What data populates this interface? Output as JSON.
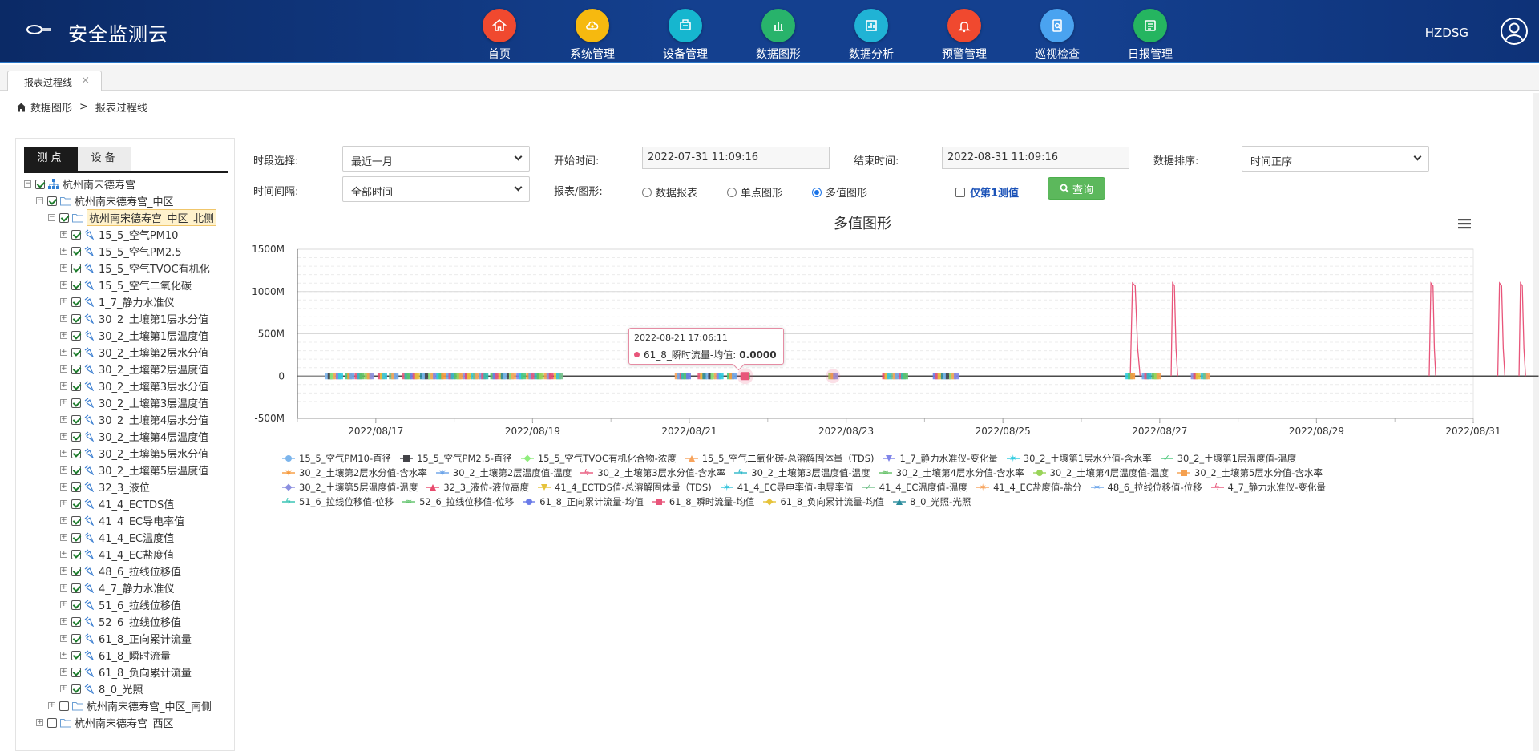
{
  "app": {
    "title": "安全监测云",
    "user": "HZDSG"
  },
  "nav": [
    {
      "label": "首页",
      "color": "#f0492f",
      "icon": "home-icon"
    },
    {
      "label": "系统管理",
      "color": "#f6b90f",
      "icon": "cloud-settings-icon"
    },
    {
      "label": "设备管理",
      "color": "#16b6cf",
      "icon": "device-icon"
    },
    {
      "label": "数据图形",
      "color": "#28b36b",
      "icon": "chart-bars-icon"
    },
    {
      "label": "数据分析",
      "color": "#20b3d5",
      "icon": "analysis-icon"
    },
    {
      "label": "预警管理",
      "color": "#f0492f",
      "icon": "bell-icon"
    },
    {
      "label": "巡视检查",
      "color": "#4aa3f0",
      "icon": "inspection-icon"
    },
    {
      "label": "日报管理",
      "color": "#25b560",
      "icon": "report-icon"
    }
  ],
  "tabs": [
    {
      "label": "报表过程线"
    }
  ],
  "breadcrumb": {
    "root": "数据图形",
    "sep": ">",
    "current": "报表过程线"
  },
  "panel": {
    "tab_points": "测点",
    "tab_devices": "设备"
  },
  "tree": [
    {
      "label": "杭州南宋德寿宫",
      "level": 0,
      "toggle": "⊟",
      "checked": true,
      "icon": "org-tree-icon"
    },
    {
      "label": "杭州南宋德寿宫_中区",
      "level": 1,
      "toggle": "⊟",
      "checked": true,
      "icon": "folder-icon"
    },
    {
      "label": "杭州南宋德寿宫_中区_北侧",
      "level": 2,
      "toggle": "⊟",
      "checked": true,
      "icon": "folder-icon",
      "selected": true
    },
    {
      "label": "15_5_空气PM10",
      "level": 3,
      "toggle": "⊞",
      "checked": true,
      "icon": "sensor-icon"
    },
    {
      "label": "15_5_空气PM2.5",
      "level": 3,
      "toggle": "⊞",
      "checked": true,
      "icon": "sensor-icon"
    },
    {
      "label": "15_5_空气TVOC有机化",
      "level": 3,
      "toggle": "⊞",
      "checked": true,
      "icon": "sensor-icon"
    },
    {
      "label": "15_5_空气二氧化碳",
      "level": 3,
      "toggle": "⊞",
      "checked": true,
      "icon": "sensor-icon"
    },
    {
      "label": "1_7_静力水准仪",
      "level": 3,
      "toggle": "⊞",
      "checked": true,
      "icon": "sensor-icon"
    },
    {
      "label": "30_2_土壤第1层水分值",
      "level": 3,
      "toggle": "⊞",
      "checked": true,
      "icon": "sensor-icon"
    },
    {
      "label": "30_2_土壤第1层温度值",
      "level": 3,
      "toggle": "⊞",
      "checked": true,
      "icon": "sensor-icon"
    },
    {
      "label": "30_2_土壤第2层水分值",
      "level": 3,
      "toggle": "⊞",
      "checked": true,
      "icon": "sensor-icon"
    },
    {
      "label": "30_2_土壤第2层温度值",
      "level": 3,
      "toggle": "⊞",
      "checked": true,
      "icon": "sensor-icon"
    },
    {
      "label": "30_2_土壤第3层水分值",
      "level": 3,
      "toggle": "⊞",
      "checked": true,
      "icon": "sensor-icon"
    },
    {
      "label": "30_2_土壤第3层温度值",
      "level": 3,
      "toggle": "⊞",
      "checked": true,
      "icon": "sensor-icon"
    },
    {
      "label": "30_2_土壤第4层水分值",
      "level": 3,
      "toggle": "⊞",
      "checked": true,
      "icon": "sensor-icon"
    },
    {
      "label": "30_2_土壤第4层温度值",
      "level": 3,
      "toggle": "⊞",
      "checked": true,
      "icon": "sensor-icon"
    },
    {
      "label": "30_2_土壤第5层水分值",
      "level": 3,
      "toggle": "⊞",
      "checked": true,
      "icon": "sensor-icon"
    },
    {
      "label": "30_2_土壤第5层温度值",
      "level": 3,
      "toggle": "⊞",
      "checked": true,
      "icon": "sensor-icon"
    },
    {
      "label": "32_3_液位",
      "level": 3,
      "toggle": "⊞",
      "checked": true,
      "icon": "sensor-icon"
    },
    {
      "label": "41_4_ECTDS值",
      "level": 3,
      "toggle": "⊞",
      "checked": true,
      "icon": "sensor-icon"
    },
    {
      "label": "41_4_EC导电率值",
      "level": 3,
      "toggle": "⊞",
      "checked": true,
      "icon": "sensor-icon"
    },
    {
      "label": "41_4_EC温度值",
      "level": 3,
      "toggle": "⊞",
      "checked": true,
      "icon": "sensor-icon"
    },
    {
      "label": "41_4_EC盐度值",
      "level": 3,
      "toggle": "⊞",
      "checked": true,
      "icon": "sensor-icon"
    },
    {
      "label": "48_6_拉线位移值",
      "level": 3,
      "toggle": "⊞",
      "checked": true,
      "icon": "sensor-icon"
    },
    {
      "label": "4_7_静力水准仪",
      "level": 3,
      "toggle": "⊞",
      "checked": true,
      "icon": "sensor-icon"
    },
    {
      "label": "51_6_拉线位移值",
      "level": 3,
      "toggle": "⊞",
      "checked": true,
      "icon": "sensor-icon"
    },
    {
      "label": "52_6_拉线位移值",
      "level": 3,
      "toggle": "⊞",
      "checked": true,
      "icon": "sensor-icon"
    },
    {
      "label": "61_8_正向累计流量",
      "level": 3,
      "toggle": "⊞",
      "checked": true,
      "icon": "sensor-icon"
    },
    {
      "label": "61_8_瞬时流量",
      "level": 3,
      "toggle": "⊞",
      "checked": true,
      "icon": "sensor-icon"
    },
    {
      "label": "61_8_负向累计流量",
      "level": 3,
      "toggle": "⊞",
      "checked": true,
      "icon": "sensor-icon"
    },
    {
      "label": "8_0_光照",
      "level": 3,
      "toggle": "⊞",
      "checked": true,
      "icon": "sensor-icon"
    },
    {
      "label": "杭州南宋德寿宫_中区_南侧",
      "level": 2,
      "toggle": "⊞",
      "checked": false,
      "icon": "folder-icon"
    },
    {
      "label": "杭州南宋德寿宫_西区",
      "level": 1,
      "toggle": "⊞",
      "checked": false,
      "icon": "folder-icon"
    }
  ],
  "filters": {
    "period_label": "时段选择:",
    "period_value": "最近一月",
    "start_label": "开始时间:",
    "start_value": "2022-07-31 11:09:16",
    "end_label": "结束时间:",
    "end_value": "2022-08-31 11:09:16",
    "sort_label": "数据排序:",
    "sort_value": "时间正序",
    "interval_label": "时间间隔:",
    "interval_value": "全部时间",
    "type_label": "报表/图形:",
    "radio_report": "数据报表",
    "radio_single": "单点图形",
    "radio_multi": "多值图形",
    "only_first": "仅第1测值",
    "query": "查询"
  },
  "tooltip": {
    "time": "2022-08-21 17:06:11",
    "series": "61_8_瞬时流量-均值:",
    "value": "0.0000",
    "color": "#e8557a"
  },
  "chart_data": {
    "type": "line",
    "title": "多值图形",
    "x_type": "time",
    "xlim": [
      "2022-08-16",
      "2022-08-31"
    ],
    "x_tick_labels": [
      "2022/08/17",
      "2022/08/19",
      "2022/08/21",
      "2022/08/23",
      "2022/08/25",
      "2022/08/27",
      "2022/08/29",
      "2022/08/31"
    ],
    "ylim": [
      -500000000,
      1500000000
    ],
    "y_ticks": [
      -500000000,
      0,
      500000000,
      1000000000,
      1500000000
    ],
    "y_tick_labels": [
      "-500M",
      "0",
      "500M",
      "1000M",
      "1500M"
    ],
    "grid": true,
    "legend_position": "bottom",
    "series": [
      {
        "name": "15_5_空气PM10-直径",
        "color": "#7cb5ec",
        "marker": "circle"
      },
      {
        "name": "15_5_空气PM2.5-直径",
        "color": "#434348",
        "marker": "square"
      },
      {
        "name": "15_5_空气TVOC有机化合物-浓度",
        "color": "#90ed7d",
        "marker": "diamond"
      },
      {
        "name": "15_5_空气二氧化碳-总溶解固体量（TDS)",
        "color": "#f7a35c",
        "marker": "triangle"
      },
      {
        "name": "1_7_静力水准仪-变化量",
        "color": "#8085e9",
        "marker": "triangle-down"
      },
      {
        "name": "30_2_土壤第1层水分值-含水率",
        "color": "#2ecbe0",
        "marker": "star"
      },
      {
        "name": "30_2_土壤第1层温度值-温度",
        "color": "#4cc77a",
        "marker": "check"
      },
      {
        "name": "30_2_土壤第2层水分值-含水率",
        "color": "#f79a3c",
        "marker": "star"
      },
      {
        "name": "30_2_土壤第2层温度值-温度",
        "color": "#6ba3e8",
        "marker": "star"
      },
      {
        "name": "30_2_土壤第3层水分值-含水率",
        "color": "#e8557a",
        "marker": "bolt"
      },
      {
        "name": "30_2_土壤第3层温度值-温度",
        "color": "#2eb8c9",
        "marker": "bolt"
      },
      {
        "name": "30_2_土壤第4层水分值-含水率",
        "color": "#5fbf62",
        "marker": "wave"
      },
      {
        "name": "30_2_土壤第4层温度值-温度",
        "color": "#9ad45a",
        "marker": "circle"
      },
      {
        "name": "30_2_土壤第5层水分值-含水率",
        "color": "#f5a04f",
        "marker": "square"
      },
      {
        "name": "30_2_土壤第5层温度值-温度",
        "color": "#8b8fe0",
        "marker": "diamond"
      },
      {
        "name": "32_3_液位-液位高度",
        "color": "#e84a6d",
        "marker": "triangle"
      },
      {
        "name": "41_4_ECTDS值-总溶解固体量（TDS)",
        "color": "#e6c33b",
        "marker": "triangle-down"
      },
      {
        "name": "41_4_EC导电率值-电导率值",
        "color": "#35c4dc",
        "marker": "star"
      },
      {
        "name": "41_4_EC温度值-温度",
        "color": "#73c08a",
        "marker": "check"
      },
      {
        "name": "41_4_EC盐度值-盐分",
        "color": "#f7a35c",
        "marker": "star"
      },
      {
        "name": "48_6_拉线位移值-位移",
        "color": "#6ea6ea",
        "marker": "star"
      },
      {
        "name": "4_7_静力水准仪-变化量",
        "color": "#e8557a",
        "marker": "bolt"
      },
      {
        "name": "51_6_拉线位移值-位移",
        "color": "#2ec0b0",
        "marker": "bolt"
      },
      {
        "name": "52_6_拉线位移值-位移",
        "color": "#5ec26a",
        "marker": "wave"
      },
      {
        "name": "61_8_正向累计流量-均值",
        "color": "#6a7be8",
        "marker": "circle"
      },
      {
        "name": "61_8_瞬时流量-均值",
        "color": "#e8557a",
        "marker": "square"
      },
      {
        "name": "61_8_负向累计流量-均值",
        "color": "#e6c33b",
        "marker": "diamond"
      },
      {
        "name": "8_0_光照-光照",
        "color": "#2a8c9c",
        "marker": "triangle"
      }
    ],
    "spike_series": {
      "name": "61_8_瞬时流量-均值",
      "spikes": [
        {
          "start": "2022-08-26 15:00",
          "peak": "2022-08-26 16:30",
          "end": "2022-08-26 18:00",
          "value": 1100000000
        },
        {
          "start": "2022-08-27 03:30",
          "peak": "2022-08-27 04:30",
          "end": "2022-08-27 05:30",
          "value": 1100000000
        },
        {
          "start": "2022-08-30 10:30",
          "peak": "2022-08-30 11:40",
          "end": "2022-08-30 12:30",
          "value": 1100000000
        },
        {
          "start": "2022-08-31 07:30",
          "peak": "2022-08-31 08:40",
          "end": "2022-08-31 09:40",
          "value": 1100000000
        },
        {
          "start": "2022-08-31 14:00",
          "peak": "2022-08-31 15:00",
          "end": "2022-08-31 16:00",
          "value": 1100000000
        }
      ]
    },
    "near_zero_point_times": [
      "2022-08-16 10:00",
      "2022-08-16 12:30",
      "2022-08-16 16:00",
      "2022-08-16 19:00",
      "2022-08-16 22:00",
      "2022-08-17 02:00",
      "2022-08-17 05:30",
      "2022-08-17 09:30",
      "2022-08-17 12:00",
      "2022-08-17 15:00",
      "2022-08-17 17:30",
      "2022-08-17 20:00",
      "2022-08-17 23:00",
      "2022-08-18 01:30",
      "2022-08-18 04:00",
      "2022-08-18 06:30",
      "2022-08-18 09:00",
      "2022-08-18 12:30",
      "2022-08-18 15:00",
      "2022-08-18 17:30",
      "2022-08-18 20:30",
      "2022-08-18 23:30",
      "2022-08-19 02:00",
      "2022-08-19 05:00",
      "2022-08-19 08:00",
      "2022-08-20 21:00",
      "2022-08-20 23:00",
      "2022-08-21 04:00",
      "2022-08-21 06:30",
      "2022-08-21 09:00",
      "2022-08-21 13:00",
      "2022-08-21 17:06",
      "2022-08-22 20:00",
      "2022-08-23 12:30",
      "2022-08-23 15:00",
      "2022-08-23 17:30",
      "2022-08-24 04:00",
      "2022-08-24 06:30",
      "2022-08-24 09:00",
      "2022-08-26 15:00",
      "2022-08-26 20:00",
      "2022-08-26 23:00",
      "2022-08-27 11:00",
      "2022-08-27 14:00"
    ]
  }
}
